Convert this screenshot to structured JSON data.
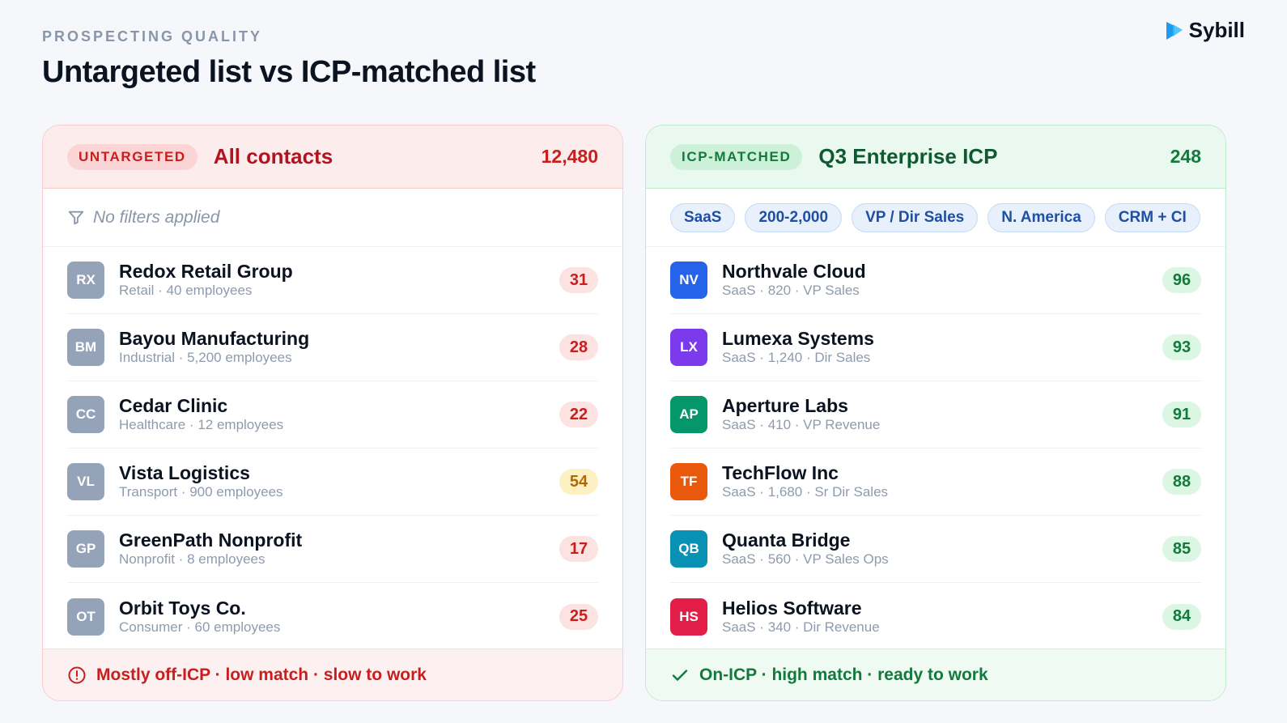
{
  "header": {
    "eyebrow": "PROSPECTING QUALITY",
    "title": "Untargeted list vs ICP-matched list",
    "brand": "Sybill"
  },
  "colors": {
    "untargeted_accent": "#c81e1e",
    "icp_accent": "#137a3c",
    "chip_accent": "#1e4fa3"
  },
  "left_panel": {
    "tag": "UNTARGETED",
    "name": "All contacts",
    "count": "12,480",
    "filter_text": "No filters applied",
    "filter_icon": "funnel-icon",
    "rows": [
      {
        "initials": "RX",
        "name": "Redox Retail Group",
        "meta": "Retail · 40 employees",
        "score": "31",
        "level": "red"
      },
      {
        "initials": "BM",
        "name": "Bayou Manufacturing",
        "meta": "Industrial · 5,200 employees",
        "score": "28",
        "level": "red"
      },
      {
        "initials": "CC",
        "name": "Cedar Clinic",
        "meta": "Healthcare · 12 employees",
        "score": "22",
        "level": "red"
      },
      {
        "initials": "VL",
        "name": "Vista Logistics",
        "meta": "Transport · 900 employees",
        "score": "54",
        "level": "amber"
      },
      {
        "initials": "GP",
        "name": "GreenPath Nonprofit",
        "meta": "Nonprofit · 8 employees",
        "score": "17",
        "level": "red"
      },
      {
        "initials": "OT",
        "name": "Orbit Toys Co.",
        "meta": "Consumer · 60 employees",
        "score": "25",
        "level": "red"
      }
    ],
    "footer": "Mostly off-ICP · low match · slow to work",
    "footer_icon": "alert-circle-icon"
  },
  "right_panel": {
    "tag": "ICP-MATCHED",
    "name": "Q3 Enterprise ICP",
    "count": "248",
    "chips": [
      "SaaS",
      "200-2,000",
      "VP / Dir Sales",
      "N. America",
      "CRM + CI"
    ],
    "rows": [
      {
        "initials": "NV",
        "name": "Northvale Cloud",
        "meta": "SaaS · 820 · VP Sales",
        "score": "96",
        "color": "#2563eb"
      },
      {
        "initials": "LX",
        "name": "Lumexa Systems",
        "meta": "SaaS · 1,240 · Dir Sales",
        "score": "93",
        "color": "#7c3aed"
      },
      {
        "initials": "AP",
        "name": "Aperture Labs",
        "meta": "SaaS · 410 · VP Revenue",
        "score": "91",
        "color": "#059669"
      },
      {
        "initials": "TF",
        "name": "TechFlow Inc",
        "meta": "SaaS · 1,680 · Sr Dir Sales",
        "score": "88",
        "color": "#ea580c"
      },
      {
        "initials": "QB",
        "name": "Quanta Bridge",
        "meta": "SaaS · 560 · VP Sales Ops",
        "score": "85",
        "color": "#0891b2"
      },
      {
        "initials": "HS",
        "name": "Helios Software",
        "meta": "SaaS · 340 · Dir Revenue",
        "score": "84",
        "color": "#e11d48"
      }
    ],
    "footer": "On-ICP · high match · ready to work",
    "footer_icon": "checkmark-icon"
  }
}
